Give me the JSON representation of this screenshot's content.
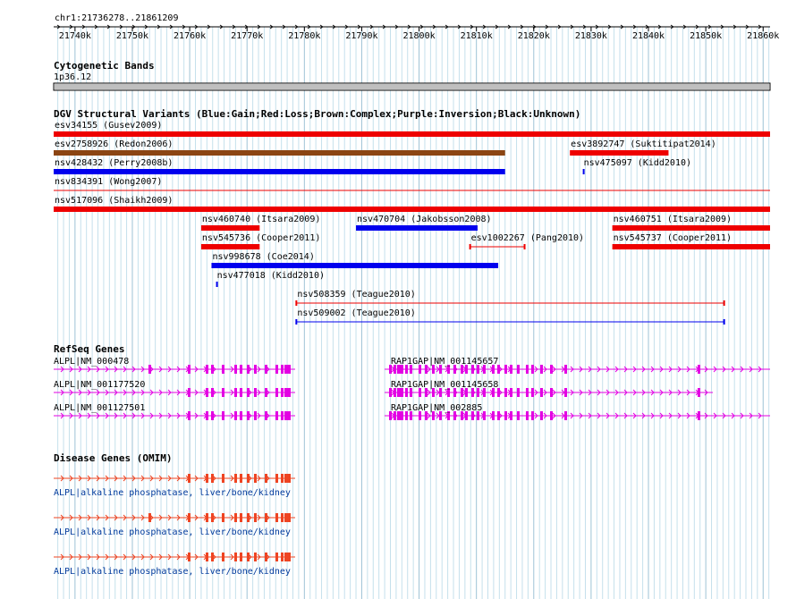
{
  "view": {
    "location": "chr1:21736278..21861209",
    "start": 21736278,
    "end": 21861209
  },
  "ruler": {
    "ticks": [
      "21740k",
      "21750k",
      "21760k",
      "21770k",
      "21780k",
      "21790k",
      "21800k",
      "21810k",
      "21820k",
      "21830k",
      "21840k",
      "21850k",
      "21860k"
    ]
  },
  "cyto": {
    "title": "Cytogenetic Bands",
    "band": "1p36.12"
  },
  "dgv": {
    "title": "DGV Structural Variants (Blue:Gain;Red:Loss;Brown:Complex;Purple:Inversion;Black:Unknown)",
    "colors": {
      "gain": "#0000ee",
      "loss": "#ee0000",
      "complex": "#8b4513"
    },
    "variants": [
      {
        "id": "esv34155 (Gusev2009)",
        "type": "loss",
        "style": "thick",
        "start": 21736278,
        "end": 21861209
      },
      {
        "id": "esv2758926 (Redon2006)",
        "type": "complex",
        "style": "thick",
        "start": 21736278,
        "end": 21815000
      },
      {
        "id": "esv3892747 (Suktitipat2014)",
        "type": "loss",
        "style": "thick",
        "start": 21826300,
        "end": 21843500
      },
      {
        "id": "nsv428432 (Perry2008b)",
        "type": "gain",
        "style": "thick",
        "start": 21736278,
        "end": 21815000
      },
      {
        "id": "nsv475097 (Kidd2010)",
        "type": "gain",
        "style": "tick",
        "start": 21828550,
        "end": 21828700
      },
      {
        "id": "nsv834391 (Wong2007)",
        "type": "loss",
        "style": "thin",
        "start": 21736278,
        "end": 21861209
      },
      {
        "id": "nsv517096 (Shaikh2009)",
        "type": "loss",
        "style": "thick",
        "start": 21736278,
        "end": 21861209
      },
      {
        "id": "nsv460740 (Itsara2009)",
        "type": "loss",
        "style": "thick",
        "start": 21762000,
        "end": 21772200
      },
      {
        "id": "nsv470704 (Jakobsson2008)",
        "type": "gain",
        "style": "thick",
        "start": 21789000,
        "end": 21810200
      },
      {
        "id": "nsv460751 (Itsara2009)",
        "type": "loss",
        "style": "thick",
        "start": 21833700,
        "end": 21861209
      },
      {
        "id": "nsv545736 (Cooper2011)",
        "type": "loss",
        "style": "thick",
        "start": 21762000,
        "end": 21772200
      },
      {
        "id": "esv1002267 (Pang2010)",
        "type": "loss",
        "style": "bracket",
        "start": 21808900,
        "end": 21818400
      },
      {
        "id": "nsv545737 (Cooper2011)",
        "type": "loss",
        "style": "thick",
        "start": 21833700,
        "end": 21861209
      },
      {
        "id": "nsv998678 (Coe2014)",
        "type": "gain",
        "style": "thick",
        "start": 21763800,
        "end": 21813800
      },
      {
        "id": "nsv477018 (Kidd2010)",
        "type": "gain",
        "style": "tick",
        "start": 21764600,
        "end": 21764800
      },
      {
        "id": "nsv508359 (Teague2010)",
        "type": "loss",
        "style": "bracket",
        "start": 21778600,
        "end": 21853200
      },
      {
        "id": "nsv509002 (Teague2010)",
        "type": "gain",
        "style": "bracket",
        "start": 21778600,
        "end": 21853200
      }
    ]
  },
  "refseq": {
    "title": "RefSeq Genes",
    "color": "#e300e3",
    "genes": [
      {
        "name": "ALPL|NM_000478"
      },
      {
        "name": "RAP1GAP|NM_001145657"
      },
      {
        "name": "ALPL|NM_001177520"
      },
      {
        "name": "RAP1GAP|NM_001145658"
      },
      {
        "name": "ALPL|NM_001127501"
      },
      {
        "name": "RAP1GAP|NM_002885"
      }
    ]
  },
  "omim": {
    "title": "Disease Genes (OMIM)",
    "color": "#ee4422",
    "label_color": "#003a9c",
    "entries": [
      {
        "label": "ALPL|alkaline phosphatase, liver/bone/kidney"
      },
      {
        "label": "ALPL|alkaline phosphatase, liver/bone/kidney"
      },
      {
        "label": "ALPL|alkaline phosphatase, liver/bone/kidney"
      }
    ]
  }
}
